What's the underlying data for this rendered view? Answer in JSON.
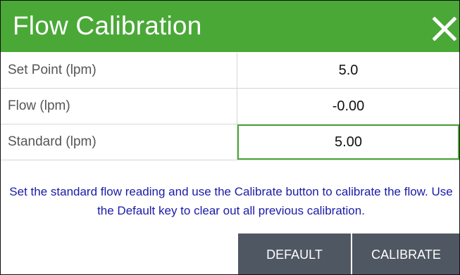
{
  "dialog": {
    "title": "Flow Calibration",
    "close_icon": "close-icon",
    "accent_color": "#4aa837"
  },
  "fields": [
    {
      "label": "Set Point (lpm)",
      "value": "5.0"
    },
    {
      "label": "Flow (lpm)",
      "value": "-0.00"
    },
    {
      "label": "Standard (lpm)",
      "value": "5.00"
    }
  ],
  "instructions": "Set the standard flow reading and use the Calibrate button to calibrate the flow.  Use the Default key to clear out all previous calibration.",
  "buttons": {
    "default_label": "DEFAULT",
    "calibrate_label": "CALIBRATE",
    "button_color": "#4f5762"
  }
}
